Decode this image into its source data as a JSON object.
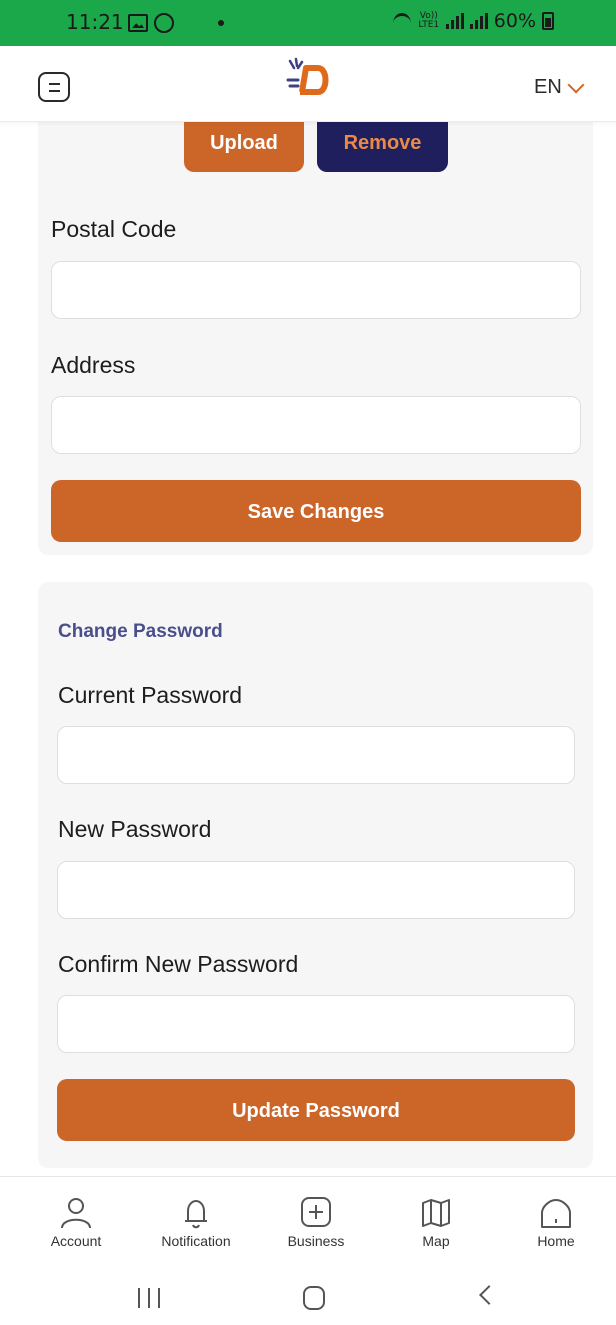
{
  "status_bar": {
    "time": "11:21",
    "volte_label": "Vo)) LTE1",
    "battery": "60%",
    "icons": [
      "gallery-icon",
      "whatsapp-icon",
      "wifi-icon",
      "signal-icon",
      "battery-icon"
    ]
  },
  "header": {
    "language": "EN",
    "icons": [
      "menu-icon",
      "logo-icon",
      "chevron-down-icon"
    ]
  },
  "profile_form": {
    "upload_label": "Upload",
    "remove_label": "Remove",
    "postal_code_label": "Postal Code",
    "postal_code_value": "",
    "address_label": "Address",
    "address_value": "",
    "save_label": "Save Changes"
  },
  "password_form": {
    "title": "Change Password",
    "current_label": "Current Password",
    "current_value": "",
    "new_label": "New Password",
    "new_value": "",
    "confirm_label": "Confirm New Password",
    "confirm_value": "",
    "update_label": "Update Password"
  },
  "bottom_nav": {
    "items": [
      {
        "label": "Account",
        "icon": "account-icon"
      },
      {
        "label": "Notification",
        "icon": "bell-icon"
      },
      {
        "label": "Business",
        "icon": "plus-square-icon"
      },
      {
        "label": "Map",
        "icon": "map-icon"
      },
      {
        "label": "Home",
        "icon": "home-icon"
      }
    ]
  },
  "colors": {
    "accent": "#cc6628",
    "navy": "#1f1f5e",
    "section_title": "#4a4f8c",
    "status_bar": "#1aa84a",
    "card_bg": "#f6f6f6"
  }
}
